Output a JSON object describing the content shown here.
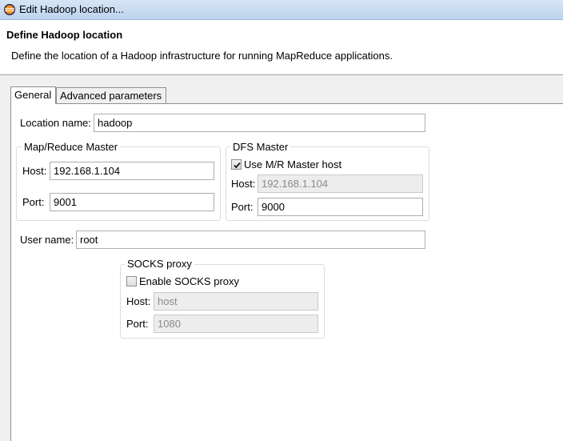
{
  "window": {
    "title": "Edit Hadoop location..."
  },
  "header": {
    "heading": "Define Hadoop location",
    "description": "Define the location of a Hadoop infrastructure for running MapReduce applications."
  },
  "tabs": [
    {
      "label": "General",
      "active": true
    },
    {
      "label": "Advanced parameters",
      "active": false
    }
  ],
  "general": {
    "location_name": {
      "label": "Location name:",
      "value": "hadoop"
    },
    "mapreduce_master": {
      "title": "Map/Reduce Master",
      "host": {
        "label": "Host:",
        "value": "192.168.1.104"
      },
      "port": {
        "label": "Port:",
        "value": "9001"
      }
    },
    "dfs_master": {
      "title": "DFS Master",
      "use_mr_host": {
        "label": "Use M/R Master host",
        "checked": true
      },
      "host": {
        "label": "Host:",
        "value": "192.168.1.104",
        "disabled": true
      },
      "port": {
        "label": "Port:",
        "value": "9000"
      }
    },
    "user_name": {
      "label": "User name:",
      "value": "root"
    },
    "socks_proxy": {
      "title": "SOCKS proxy",
      "enable": {
        "label": "Enable SOCKS proxy",
        "checked": false
      },
      "host": {
        "label": "Host:",
        "value": "host",
        "disabled": true
      },
      "port": {
        "label": "Port:",
        "value": "1080",
        "disabled": true
      }
    }
  }
}
